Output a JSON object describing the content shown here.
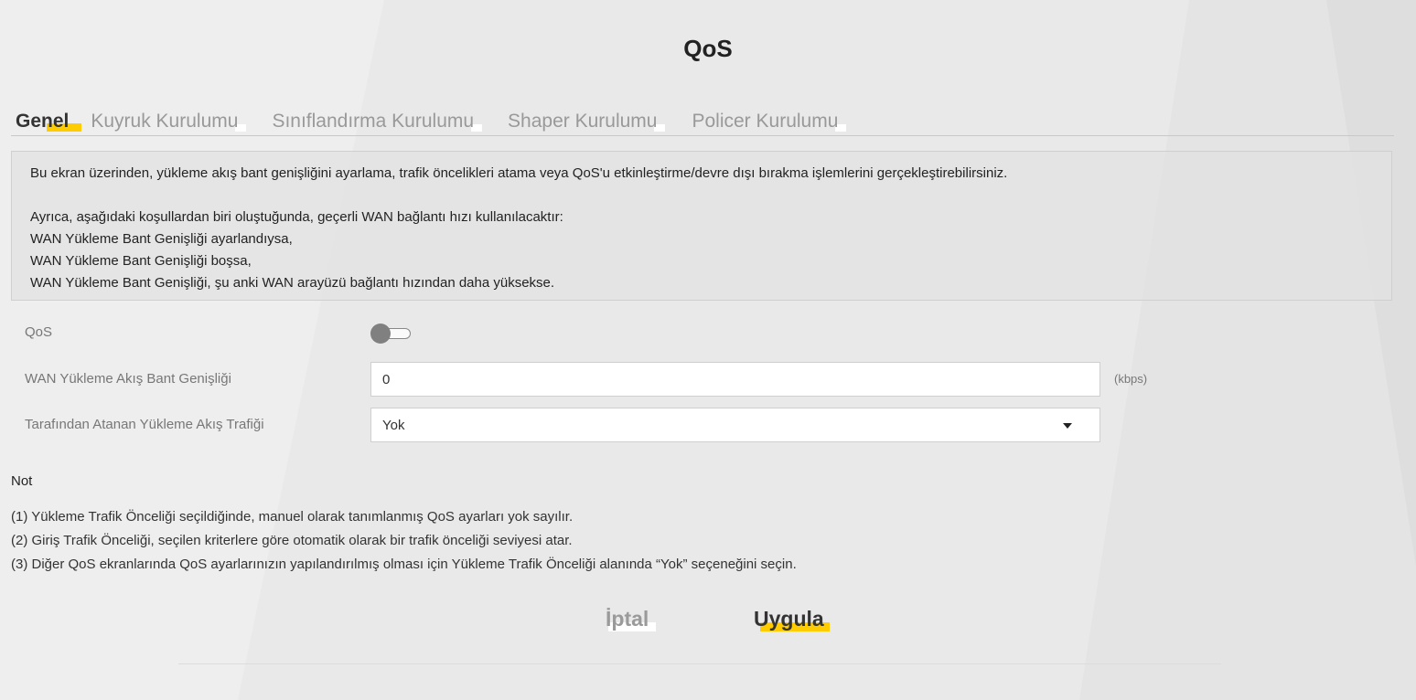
{
  "page": {
    "title": "QoS"
  },
  "tabs": [
    {
      "label": "Genel",
      "active": true
    },
    {
      "label": "Kuyruk Kurulumu",
      "active": false
    },
    {
      "label": "Sınıflandırma Kurulumu",
      "active": false
    },
    {
      "label": "Shaper Kurulumu",
      "active": false
    },
    {
      "label": "Policer Kurulumu",
      "active": false
    }
  ],
  "info": {
    "line1": "Bu ekran üzerinden, yükleme akış bant genişliğini ayarlama, trafik öncelikleri atama veya QoS'u etkinleştirme/devre dışı bırakma işlemlerini gerçekleştirebilirsiniz.",
    "line2": "Ayrıca, aşağıdaki koşullardan biri oluştuğunda, geçerli WAN bağlantı hızı kullanılacaktır:",
    "line3": "WAN Yükleme Bant Genişliği ayarlandıysa,",
    "line4": "WAN Yükleme Bant Genişliği boşsa,",
    "line5": "WAN Yükleme Bant Genişliği, şu anki WAN arayüzü bağlantı hızından daha yüksekse."
  },
  "form": {
    "qos_label": "QoS",
    "qos_enabled": false,
    "bandwidth_label": "WAN Yükleme Akış Bant Genişliği",
    "bandwidth_value": "0",
    "bandwidth_unit": "(kbps)",
    "traffic_label": "Tarafından Atanan Yükleme Akış Trafiği",
    "traffic_value": "Yok"
  },
  "notes": {
    "title": "Not",
    "items": [
      "(1) Yükleme Trafik Önceliği seçildiğinde, manuel olarak tanımlanmış QoS ayarları yok sayılır.",
      "(2) Giriş Trafik Önceliği, seçilen kriterlere göre otomatik olarak bir trafik önceliği seviyesi atar.",
      "(3) Diğer QoS ekranlarında QoS ayarlarınızın yapılandırılmış olması için Yükleme Trafik Önceliği alanında “Yok” seçeneğini seçin."
    ]
  },
  "buttons": {
    "cancel_label": "İptal",
    "apply_label": "Uygula"
  },
  "colors": {
    "accent": "#ffcc00",
    "background": "#ececec",
    "muted_text": "#999999"
  }
}
